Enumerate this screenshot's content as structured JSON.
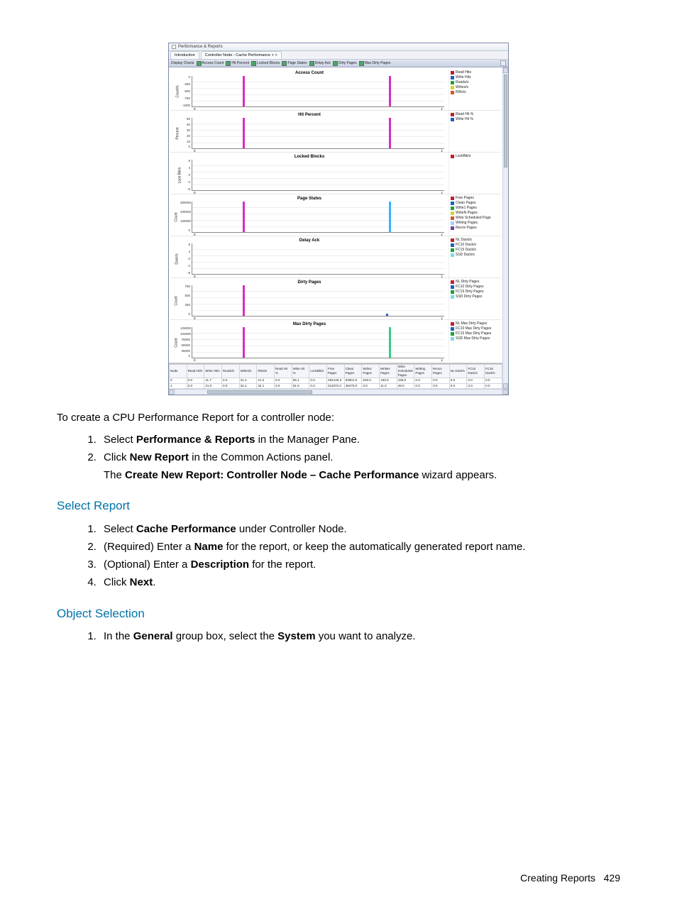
{
  "window": {
    "title": "Performance & Reports",
    "tabs": {
      "introduction": "Introduction",
      "active": "Controller Node - Cache Performance"
    },
    "toolbar": {
      "display_charts": "Display Charts",
      "items": [
        "Access Count",
        "Hit Percent",
        "Locked Blocks",
        "Page States",
        "Delay Ack",
        "Dirty Pages",
        "Max Dirty Pages"
      ]
    }
  },
  "charts": {
    "access_count": {
      "title": "Access Count",
      "ylabel": "Count/s",
      "yticks": [
        "0",
        "-250",
        "-500",
        "-750",
        "-1000"
      ],
      "xticks": [
        "0",
        "1"
      ],
      "legend": [
        {
          "label": "Read Hits",
          "color": "#c01f2e"
        },
        {
          "label": "Write Hits",
          "color": "#1f5fc0"
        },
        {
          "label": "Reads/s",
          "color": "#1fa03e"
        },
        {
          "label": "Writes/s",
          "color": "#d8d030"
        },
        {
          "label": "RWs/s",
          "color": "#d05a2a"
        }
      ]
    },
    "hit_percent": {
      "title": "Hit Percent",
      "ylabel": "Percent",
      "yticks": [
        "50",
        "40",
        "30",
        "20",
        "10",
        "0"
      ],
      "xticks": [
        "0",
        "1"
      ],
      "legend": [
        {
          "label": "Read Hit %",
          "color": "#c01f2e"
        },
        {
          "label": "Write Hit %",
          "color": "#1f5fc0"
        }
      ]
    },
    "locked_blocks": {
      "title": "Locked Blocks",
      "ylabel": "Lock Blk/s",
      "yticks": [
        "8",
        "4",
        "0",
        "-4",
        "-8"
      ],
      "xticks": [
        "0",
        "1"
      ],
      "legend": [
        {
          "label": "LockBlk/s",
          "color": "#c01f2e"
        }
      ]
    },
    "page_states": {
      "title": "Page States",
      "ylabel": "Count",
      "yticks": [
        "300000",
        "200000",
        "100000",
        "0"
      ],
      "xticks": [
        "0",
        "1"
      ],
      "legend": [
        {
          "label": "Free Pages",
          "color": "#c01f2e"
        },
        {
          "label": "Clean Pages",
          "color": "#1f5fc0"
        },
        {
          "label": "Write1 Pages",
          "color": "#1fa03e"
        },
        {
          "label": "WriteN Pages",
          "color": "#d8d030"
        },
        {
          "label": "Write Scheduled Page",
          "color": "#d05a2a"
        },
        {
          "label": "Writing Pages",
          "color": "#a0d0ff"
        },
        {
          "label": "Recov Pages",
          "color": "#7040a0"
        }
      ]
    },
    "delay_ack": {
      "title": "Delay Ack",
      "ylabel": "Dack/s",
      "yticks": [
        "8",
        "4",
        "0",
        "-4",
        "-8"
      ],
      "xticks": [
        "0",
        "1"
      ],
      "legend": [
        {
          "label": "NL Dack/s",
          "color": "#c01f2e"
        },
        {
          "label": "FC10 Dack/s",
          "color": "#1f5fc0"
        },
        {
          "label": "FC15 Dack/s",
          "color": "#1fa03e"
        },
        {
          "label": "SSD Dack/s",
          "color": "#80d8e8"
        }
      ]
    },
    "dirty_pages": {
      "title": "Dirty Pages",
      "ylabel": "Count",
      "yticks": [
        "750",
        "500",
        "250",
        "0"
      ],
      "xticks": [
        "0",
        "1"
      ],
      "legend": [
        {
          "label": "NL Dirty Pages",
          "color": "#c01f2e"
        },
        {
          "label": "FC10 Dirty Pages",
          "color": "#1f5fc0"
        },
        {
          "label": "FC15 Dirty Pages",
          "color": "#1fa03e"
        },
        {
          "label": "SSD Dirty Pages",
          "color": "#80d8e8"
        }
      ]
    },
    "max_dirty_pages": {
      "title": "Max Dirty Pages",
      "ylabel": "Count",
      "yticks": [
        "125000",
        "100000",
        "75000",
        "50000",
        "25000",
        "0"
      ],
      "xticks": [
        "0",
        "1"
      ],
      "legend": [
        {
          "label": "NL Max Dirty Pages",
          "color": "#c01f2e"
        },
        {
          "label": "FC10 Max Dirty Pages",
          "color": "#1f5fc0"
        },
        {
          "label": "FC15 Max Dirty Pages",
          "color": "#1fa03e"
        },
        {
          "label": "SSD Max Dirty Pages",
          "color": "#80d8e8"
        }
      ]
    }
  },
  "table": {
    "headers": [
      "Node",
      "Read Hit/s",
      "Write Hit/s",
      "Reads/s",
      "Writes/s",
      "RWs/s",
      "Read Hit %",
      "Write Hit %",
      "LockBlk/s",
      "Free Pages",
      "Clean Pages",
      "Write1 Pages",
      "WriteN Pages",
      "Write Scheduled Pages",
      "Writing Pages",
      "Recov Pages",
      "NL Dack/s",
      "FC10 Dack/s",
      "FC15 Dack/s"
    ],
    "rows": [
      [
        "0",
        "0.0",
        "11.7",
        "0.0",
        "21.2",
        "21.2",
        "0.0",
        "55.1",
        "0.0",
        "294146.3",
        "63601.0",
        "548.0",
        "193.0",
        "158.0",
        "0.0",
        "0.0",
        "0.0",
        "0.0",
        "0.0"
      ],
      [
        "1",
        "0.0",
        "21.0",
        "0.0",
        "34.1",
        "34.1",
        "0.0",
        "61.5",
        "0.0",
        "311570.3",
        "48476.0",
        "3.0",
        "11.0",
        "49.0",
        "0.0",
        "0.0",
        "0.0",
        "0.0",
        "0.0"
      ]
    ]
  },
  "doc": {
    "intro": "To create a CPU Performance Report for a controller node:",
    "steps1": {
      "s1a": "Select ",
      "s1b": "Performance & Reports",
      "s1c": " in the Manager Pane.",
      "s2a": "Click ",
      "s2b": "New Report",
      "s2c": " in the Common Actions panel.",
      "s2d": "The ",
      "s2e": "Create New Report: Controller Node – Cache Performance",
      "s2f": " wizard appears."
    },
    "select_report": {
      "heading": "Select Report",
      "s1a": "Select ",
      "s1b": "Cache Performance",
      "s1c": " under Controller Node.",
      "s2a": "(Required) Enter a ",
      "s2b": "Name",
      "s2c": " for the report, or keep the automatically generated report name.",
      "s3a": "(Optional) Enter a ",
      "s3b": "Description",
      "s3c": " for the report.",
      "s4a": "Click ",
      "s4b": "Next",
      "s4c": "."
    },
    "object_selection": {
      "heading": "Object Selection",
      "s1a": "In the ",
      "s1b": "General",
      "s1c": " group box, select the ",
      "s1d": "System",
      "s1e": " you want to analyze."
    }
  },
  "footer": {
    "label": "Creating Reports",
    "page": "429"
  },
  "chart_data": [
    {
      "type": "bar",
      "title": "Access Count",
      "ylabel": "Count/s",
      "categories": [
        "0",
        "1"
      ],
      "ylim": [
        -1000,
        0
      ],
      "series": [
        {
          "name": "Read Hits",
          "values": [
            0,
            0
          ]
        },
        {
          "name": "Write Hits",
          "values": [
            0,
            0
          ]
        },
        {
          "name": "Reads/s",
          "values": [
            0,
            0
          ]
        },
        {
          "name": "Writes/s",
          "values": [
            0,
            0
          ]
        },
        {
          "name": "RWs/s",
          "values": [
            0,
            0
          ]
        }
      ],
      "bars": [
        {
          "x": 0.2,
          "color": "#d82cc4",
          "h": 1.0
        },
        {
          "x": 0.78,
          "color": "#d82cc4",
          "h": 1.0
        }
      ]
    },
    {
      "type": "bar",
      "title": "Hit Percent",
      "ylabel": "Percent",
      "categories": [
        "0",
        "1"
      ],
      "ylim": [
        0,
        50
      ],
      "series": [
        {
          "name": "Read Hit %",
          "values": [
            0,
            0
          ]
        },
        {
          "name": "Write Hit %",
          "values": [
            55.1,
            61.5
          ]
        }
      ],
      "bars": [
        {
          "x": 0.2,
          "color": "#d82cc4",
          "h": 1.0
        },
        {
          "x": 0.78,
          "color": "#d82cc4",
          "h": 1.0
        }
      ]
    },
    {
      "type": "bar",
      "title": "Locked Blocks",
      "ylabel": "Lock Blk/s",
      "categories": [
        "0",
        "1"
      ],
      "ylim": [
        -8,
        8
      ],
      "series": [
        {
          "name": "LockBlk/s",
          "values": [
            0,
            0
          ]
        }
      ],
      "bars": []
    },
    {
      "type": "bar",
      "title": "Page States",
      "ylabel": "Count",
      "categories": [
        "0",
        "1"
      ],
      "ylim": [
        0,
        300000
      ],
      "series": [
        {
          "name": "Free Pages",
          "values": [
            294146,
            311570
          ]
        },
        {
          "name": "Clean Pages",
          "values": [
            63601,
            48476
          ]
        },
        {
          "name": "Write1 Pages",
          "values": [
            548,
            3
          ]
        },
        {
          "name": "WriteN Pages",
          "values": [
            193,
            11
          ]
        },
        {
          "name": "Write Scheduled Page",
          "values": [
            158,
            49
          ]
        },
        {
          "name": "Writing Pages",
          "values": [
            0,
            0
          ]
        },
        {
          "name": "Recov Pages",
          "values": [
            0,
            0
          ]
        }
      ],
      "bars": [
        {
          "x": 0.2,
          "color": "#d82cc4",
          "h": 1.0
        },
        {
          "x": 0.78,
          "color": "#33b6ff",
          "h": 1.0
        }
      ]
    },
    {
      "type": "bar",
      "title": "Delay Ack",
      "ylabel": "Dack/s",
      "categories": [
        "0",
        "1"
      ],
      "ylim": [
        -8,
        8
      ],
      "series": [
        {
          "name": "NL Dack/s",
          "values": [
            0,
            0
          ]
        },
        {
          "name": "FC10 Dack/s",
          "values": [
            0,
            0
          ]
        },
        {
          "name": "FC15 Dack/s",
          "values": [
            0,
            0
          ]
        },
        {
          "name": "SSD Dack/s",
          "values": [
            0,
            0
          ]
        }
      ],
      "bars": []
    },
    {
      "type": "bar",
      "title": "Dirty Pages",
      "ylabel": "Count",
      "categories": [
        "0",
        "1"
      ],
      "ylim": [
        0,
        750
      ],
      "series": [
        {
          "name": "NL Dirty Pages",
          "values": [
            0,
            0
          ]
        },
        {
          "name": "FC10 Dirty Pages",
          "values": [
            0,
            40
          ]
        },
        {
          "name": "FC15 Dirty Pages",
          "values": [
            0,
            0
          ]
        },
        {
          "name": "SSD Dirty Pages",
          "values": [
            0,
            0
          ]
        }
      ],
      "bars": [
        {
          "x": 0.2,
          "color": "#d82cc4",
          "h": 1.0
        },
        {
          "x": 0.77,
          "color": "#2a5fd0",
          "h": 0.06
        }
      ]
    },
    {
      "type": "bar",
      "title": "Max Dirty Pages",
      "ylabel": "Count",
      "categories": [
        "0",
        "1"
      ],
      "ylim": [
        0,
        125000
      ],
      "series": [
        {
          "name": "NL Max Dirty Pages",
          "values": [
            0,
            0
          ]
        },
        {
          "name": "FC10 Max Dirty Pages",
          "values": [
            0,
            0
          ]
        },
        {
          "name": "FC15 Max Dirty Pages",
          "values": [
            0,
            0
          ]
        },
        {
          "name": "SSD Max Dirty Pages",
          "values": [
            0,
            0
          ]
        }
      ],
      "bars": [
        {
          "x": 0.2,
          "color": "#d82cc4",
          "h": 1.0
        },
        {
          "x": 0.78,
          "color": "#33d080",
          "h": 1.0
        }
      ]
    }
  ]
}
